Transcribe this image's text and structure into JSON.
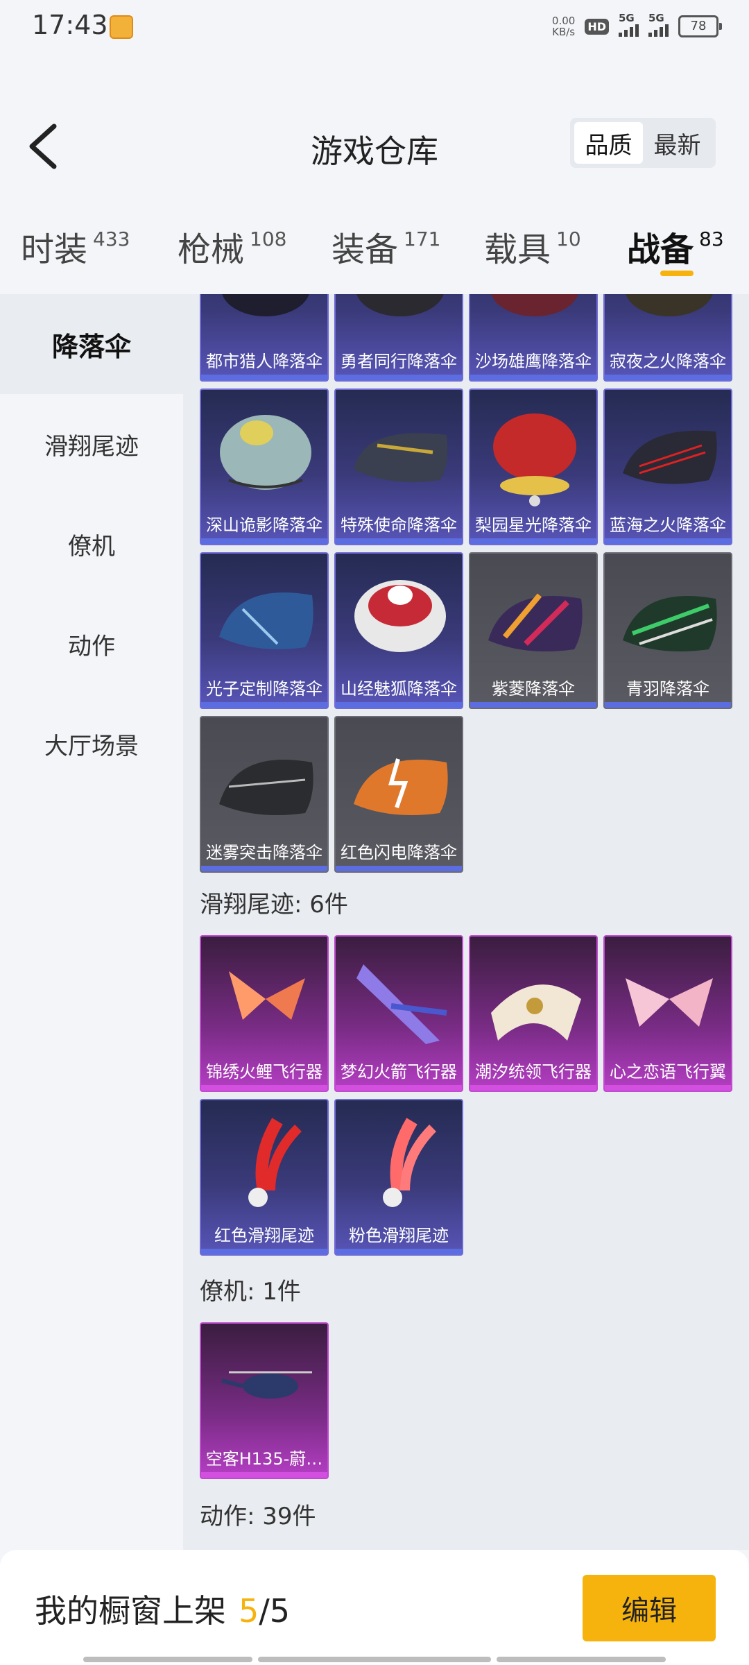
{
  "status": {
    "time": "17:43",
    "net_speed_top": "0.00",
    "net_speed_bottom": "KB/s",
    "hd_label": "HD",
    "sim1_label": "5G",
    "sim2_label": "5G",
    "battery": "78"
  },
  "header": {
    "title": "游戏仓库",
    "sort_options": [
      "品质",
      "最新"
    ]
  },
  "tabs": [
    {
      "label": "时装",
      "count": "433"
    },
    {
      "label": "枪械",
      "count": "108"
    },
    {
      "label": "装备",
      "count": "171"
    },
    {
      "label": "载具",
      "count": "10"
    },
    {
      "label": "战备",
      "count": "83"
    }
  ],
  "sidebar": {
    "items": [
      "降落伞",
      "滑翔尾迹",
      "僚机",
      "动作",
      "大厅场景"
    ]
  },
  "parachutes": [
    "都市猎人降落伞",
    "勇者同行降落伞",
    "沙场雄鹰降落伞",
    "寂夜之火降落伞",
    "深山诡影降落伞",
    "特殊使命降落伞",
    "梨园星光降落伞",
    "蓝海之火降落伞",
    "光子定制降落伞",
    "山经魅狐降落伞",
    "紫菱降落伞",
    "青羽降落伞",
    "迷雾突击降落伞",
    "红色闪电降落伞"
  ],
  "trails_section": "滑翔尾迹: 6件",
  "trails": [
    "锦绣火鲤飞行器",
    "梦幻火箭飞行器",
    "潮汐统领飞行器",
    "心之恋语飞行翼",
    "红色滑翔尾迹",
    "粉色滑翔尾迹"
  ],
  "wingman_section": "僚机: 1件",
  "wingmen": [
    "空客H135-蔚…"
  ],
  "actions_section": "动作: 39件",
  "bottom": {
    "showcase_label": "我的橱窗上架",
    "showcase_count": "5",
    "showcase_total": "/5",
    "edit_label": "编辑"
  },
  "colors": {
    "accent": "#f6b30d",
    "card_blue": "#5b6de0",
    "card_purple": "#d24fe0",
    "card_gray": "#5a5a62"
  }
}
